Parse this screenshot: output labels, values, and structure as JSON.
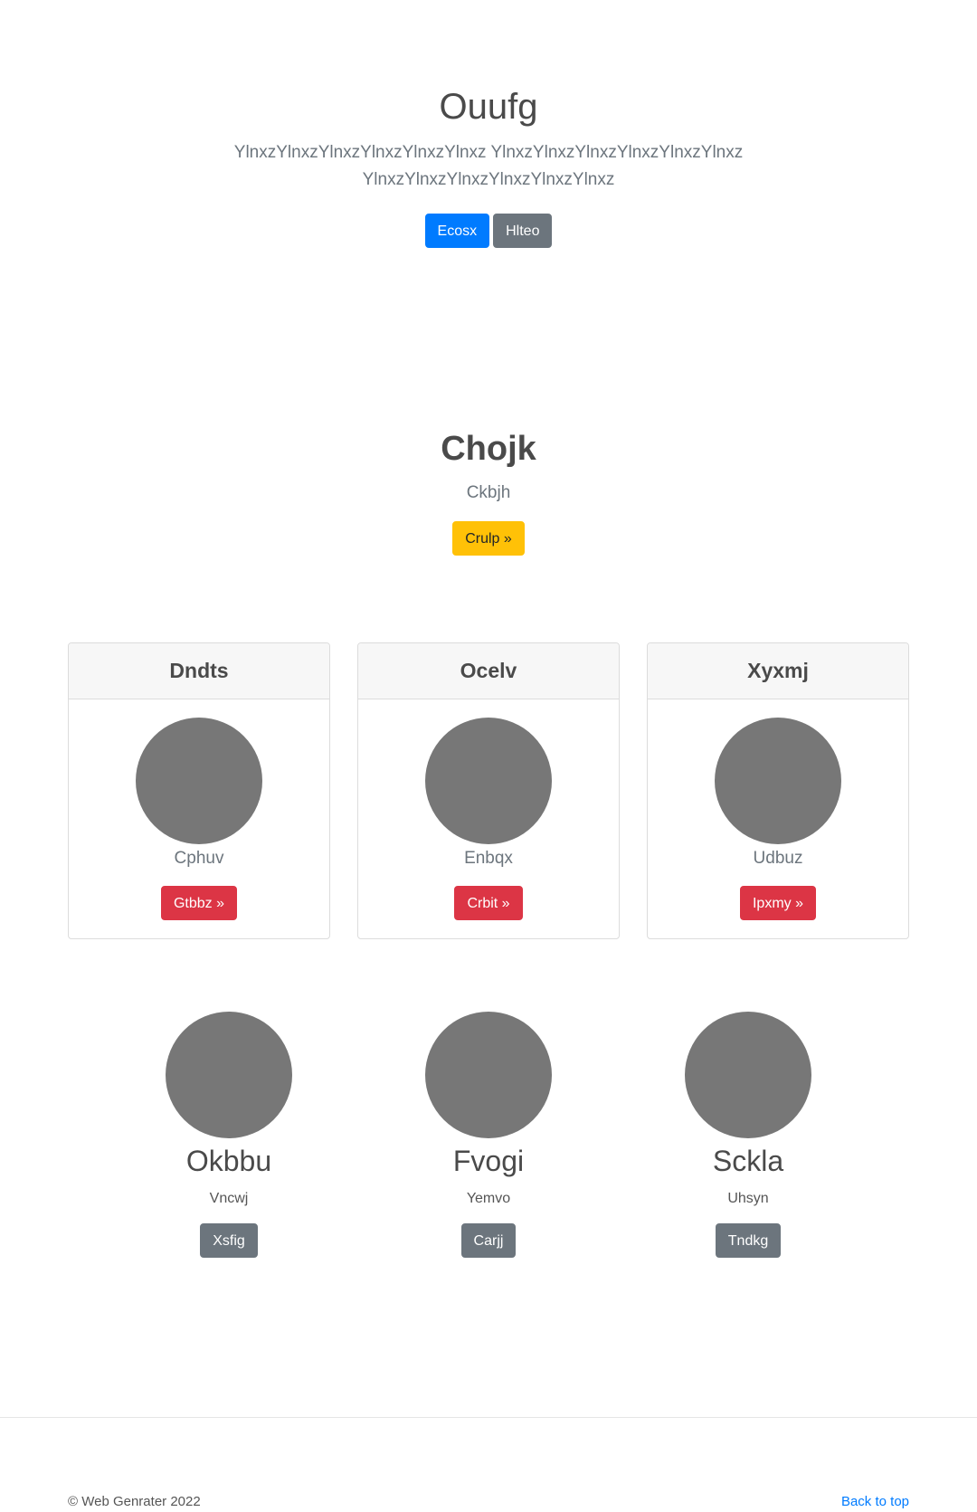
{
  "hero": {
    "title": "Ouufg",
    "lead": "YlnxzYlnxzYlnxzYlnxzYlnxzYlnxz YlnxzYlnxzYlnxzYlnxzYlnxzYlnxz YlnxzYlnxzYlnxzYlnxzYlnxzYlnxz",
    "primary_button": "Ecosx",
    "secondary_button": "Hlteo"
  },
  "feature": {
    "title": "Chojk",
    "subtitle": "Ckbjh",
    "button": "Crulp »"
  },
  "cards": [
    {
      "title": "Dndts",
      "text": "Cphuv",
      "button": "Gtbbz »"
    },
    {
      "title": "Ocelv",
      "text": "Enbqx",
      "button": "Crbit »"
    },
    {
      "title": "Xyxmj",
      "text": "Udbuz",
      "button": "Ipxmy »"
    }
  ],
  "people": [
    {
      "name": "Okbbu",
      "role": "Vncwj",
      "button": "Xsfig"
    },
    {
      "name": "Fvogi",
      "role": "Yemvo",
      "button": "Carjj"
    },
    {
      "name": "Sckla",
      "role": "Uhsyn",
      "button": "Tndkg"
    }
  ],
  "footer": {
    "copyright": "© Web Genrater 2022",
    "back_to_top": "Back to top"
  },
  "colors": {
    "primary": "#007bff",
    "secondary": "#6c757d",
    "warning": "#ffc107",
    "danger": "#dc3545",
    "placeholder": "#777777"
  }
}
